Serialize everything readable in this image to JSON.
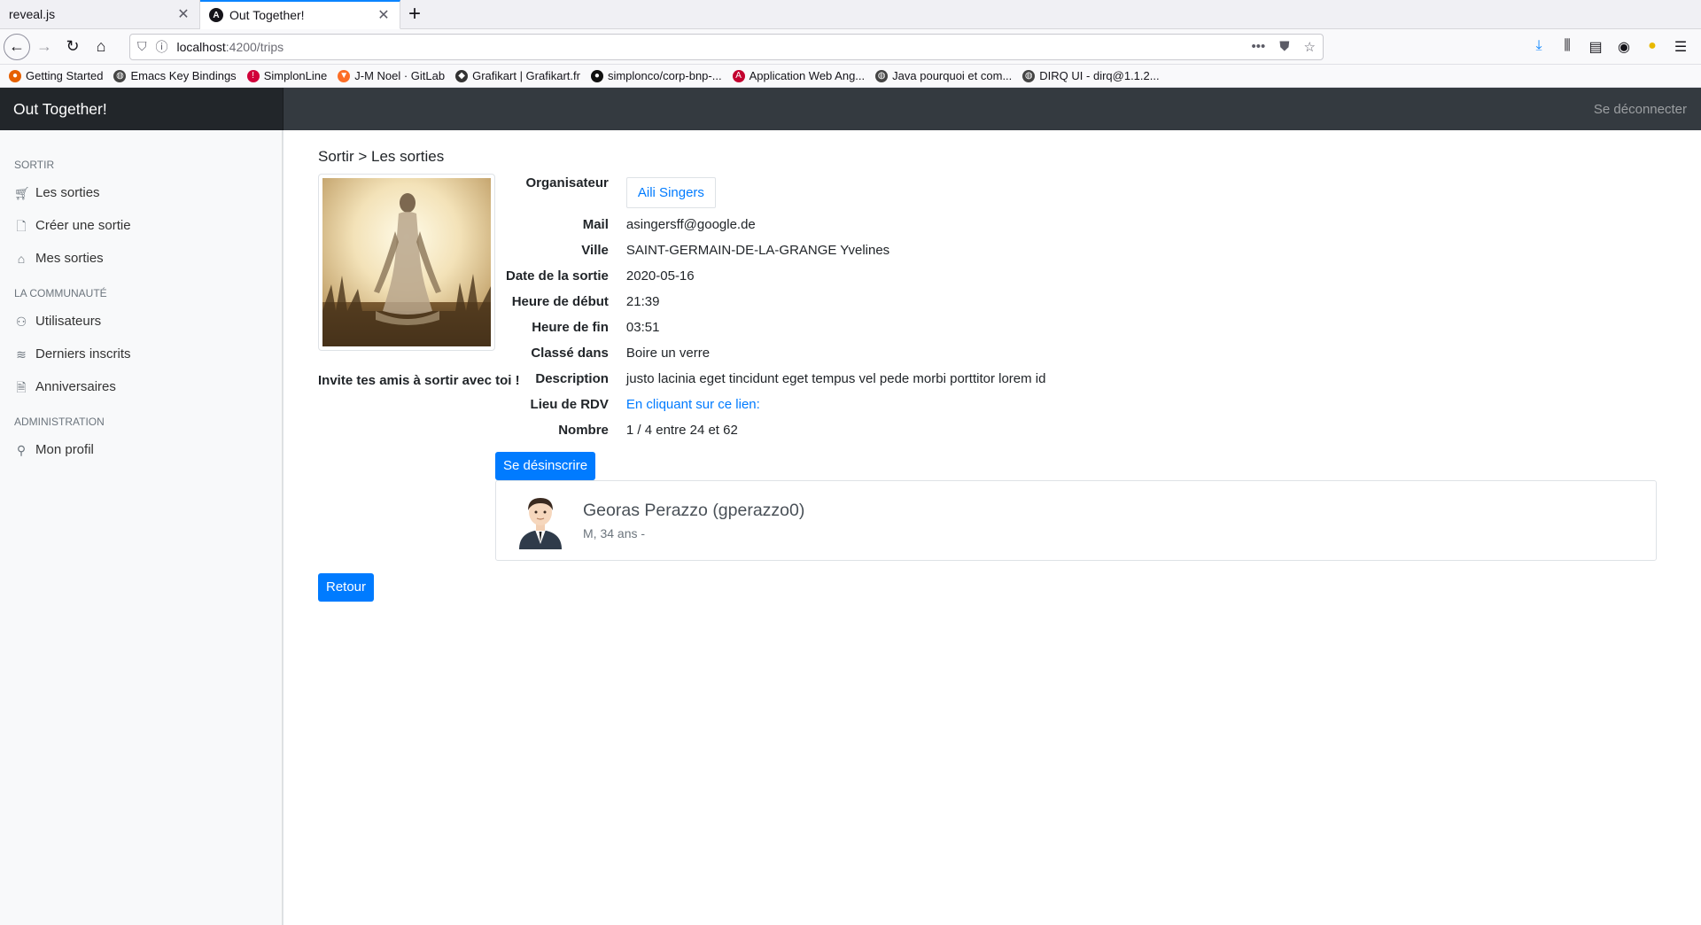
{
  "browser": {
    "tabs": [
      {
        "title": "reveal.js",
        "active": false
      },
      {
        "title": "Out Together!",
        "active": true
      }
    ],
    "url_host": "localhost",
    "url_path": ":4200/trips",
    "bookmarks": [
      {
        "label": "Getting Started",
        "icon": "firefox-icon",
        "color": "#e66000"
      },
      {
        "label": "Emacs Key Bindings",
        "icon": "globe-icon",
        "color": "#444"
      },
      {
        "label": "SimplonLine",
        "icon": "simplon-icon",
        "color": "#d1003a"
      },
      {
        "label": "J-M Noel · GitLab",
        "icon": "gitlab-icon",
        "color": "#fc6d26"
      },
      {
        "label": "Grafikart | Grafikart.fr",
        "icon": "grafikart-icon",
        "color": "#333"
      },
      {
        "label": "simplonco/corp-bnp-...",
        "icon": "github-icon",
        "color": "#111"
      },
      {
        "label": "Application Web Ang...",
        "icon": "angular-icon",
        "color": "#c3002f"
      },
      {
        "label": "Java pourquoi et com...",
        "icon": "globe-icon",
        "color": "#444"
      },
      {
        "label": "DIRQ UI - dirq@1.1.2...",
        "icon": "globe-icon",
        "color": "#444"
      }
    ]
  },
  "app": {
    "brand": "Out Together!",
    "logout": "Se déconnecter"
  },
  "sidebar": {
    "groups": [
      {
        "heading": "SORTIR",
        "items": [
          {
            "label": "Les sorties",
            "icon": "cart-icon"
          },
          {
            "label": "Créer une sortie",
            "icon": "file-icon"
          },
          {
            "label": "Mes sorties",
            "icon": "home-icon"
          }
        ]
      },
      {
        "heading": "LA COMMUNAUTÉ",
        "items": [
          {
            "label": "Utilisateurs",
            "icon": "users-icon"
          },
          {
            "label": "Derniers inscrits",
            "icon": "layers-icon"
          },
          {
            "label": "Anniversaires",
            "icon": "file-text-icon"
          }
        ]
      },
      {
        "heading": "ADMINISTRATION",
        "items": [
          {
            "label": "Mon profil",
            "icon": "user-icon"
          }
        ]
      }
    ]
  },
  "main": {
    "breadcrumb": "Sortir > Les sorties",
    "invite": "Invite tes amis à sortir avec toi !",
    "fields": {
      "organisateur_label": "Organisateur",
      "organisateur_value": "Aili Singers",
      "mail_label": "Mail",
      "mail_value": "asingersff@google.de",
      "ville_label": "Ville",
      "ville_value": "SAINT-GERMAIN-DE-LA-GRANGE Yvelines",
      "date_label": "Date de la sortie",
      "date_value": "2020-05-16",
      "debut_label": "Heure de début",
      "debut_value": "21:39",
      "fin_label": "Heure de fin",
      "fin_value": "03:51",
      "classe_label": "Classé dans",
      "classe_value": "Boire un verre",
      "description_label": "Description",
      "description_value": "justo lacinia eget tincidunt eget tempus vel pede morbi porttitor lorem id",
      "rdv_label": "Lieu de RDV",
      "rdv_value": "En cliquant sur ce lien:",
      "nombre_label": "Nombre",
      "nombre_value": "1 / 4 entre 24 et 62"
    },
    "unsubscribe_label": "Se désinscrire",
    "participant": {
      "name": "Georas Perazzo (gperazzo0)",
      "meta": "M, 34 ans -"
    },
    "back_label": "Retour"
  }
}
